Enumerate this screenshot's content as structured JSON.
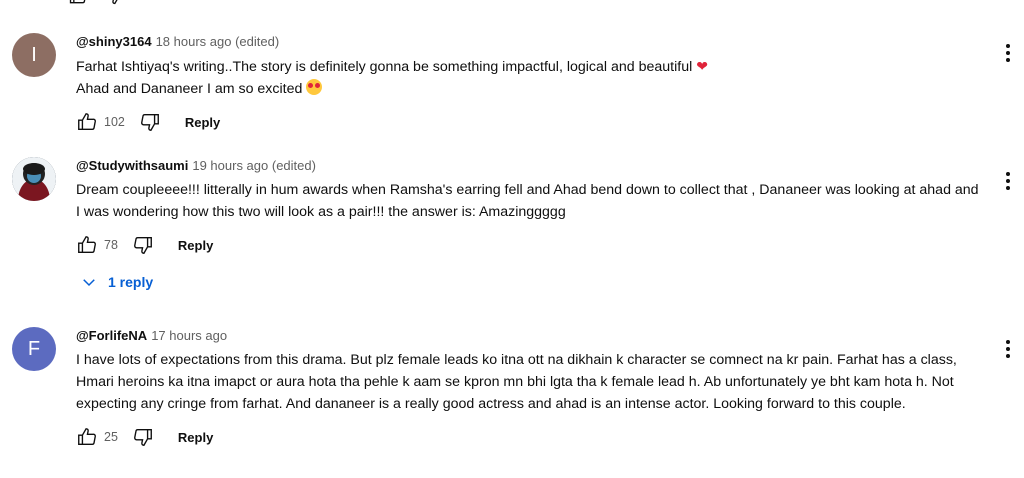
{
  "comments": [
    {
      "handle": "@shiny3164",
      "time": "18 hours ago (edited)",
      "avatar_letter": "I",
      "avatar_color": "#8d6e63",
      "text_line1": "Farhat Ishtiyaq's writing..The story is definitely gonna be something impactful, logical and beautiful",
      "text_line2": "Ahad and Dananeer I am so excited",
      "likes": "102",
      "reply_label": "Reply"
    },
    {
      "handle": "@Studywithsaumi",
      "time": "19 hours ago (edited)",
      "avatar_letter": "",
      "avatar_color": "#1b2a3a",
      "text": "Dream coupleeee!!! litterally in hum awards when Ramsha's earring fell and Ahad bend down to collect that , Dananeer was looking at ahad and I was wondering how this two will look as a pair!!! the answer is: Amazinggggg",
      "likes": "78",
      "reply_label": "Reply",
      "replies_label": "1 reply"
    },
    {
      "handle": "@ForlifeNA",
      "time": "17 hours ago",
      "avatar_letter": "F",
      "avatar_color": "#5c6bc0",
      "text": "I have lots of expectations from this drama. But plz female leads ko itna ott na dikhain k character se comnect na kr pain. Farhat has a class, Hmari heroins ka itna imapct or aura hota tha pehle k aam se kpron mn bhi lgta tha k female lead h. Ab unfortunately ye bht kam hota h. Not expecting any cringe from farhat. And dananeer is a really good actress and ahad is an intense actor. Looking forward to this couple.",
      "likes": "25",
      "reply_label": "Reply"
    }
  ],
  "icons": {
    "like": "thumb-up-icon",
    "dislike": "thumb-down-icon",
    "menu": "more-vert-icon",
    "expand": "chevron-down-icon"
  }
}
